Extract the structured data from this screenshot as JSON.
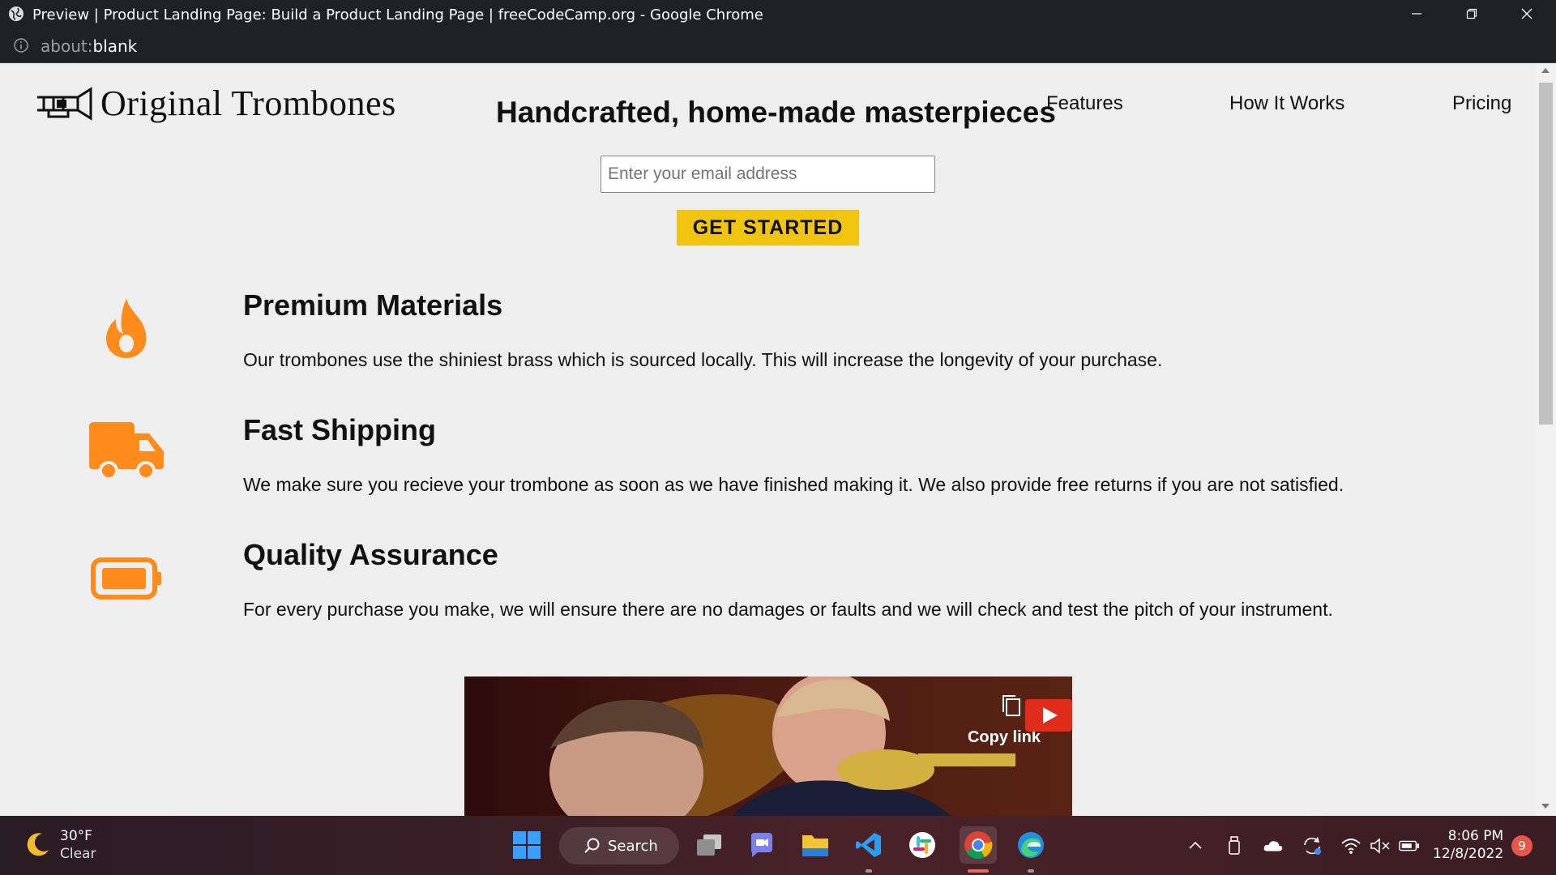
{
  "window": {
    "title": "Preview | Product Landing Page: Build a Product Landing Page | freeCodeCamp.org - Google Chrome"
  },
  "address_bar": {
    "url_prefix": "about:",
    "url_main": "blank"
  },
  "page": {
    "brand": "Original Trombones",
    "nav": [
      {
        "label": "Features"
      },
      {
        "label": "How It Works"
      },
      {
        "label": "Pricing"
      }
    ],
    "hero_title": "Handcrafted, home-made masterpieces",
    "email_placeholder": "Enter your email address",
    "cta_label": "GET STARTED",
    "features": [
      {
        "icon": "flame-icon",
        "title": "Premium Materials",
        "description": "Our trombones use the shiniest brass which is sourced locally. This will increase the longevity of your purchase."
      },
      {
        "icon": "truck-icon",
        "title": "Fast Shipping",
        "description": "We make sure you recieve your trombone as soon as we have finished making it. We also provide free returns if you are not satisfied."
      },
      {
        "icon": "battery-icon",
        "title": "Quality Assurance",
        "description": "For every purchase you make, we will ensure there are no damages or faults and we will check and test the pitch of your instrument."
      }
    ],
    "video": {
      "copy_link": "Copy link"
    },
    "accent_color": "#f1c40f",
    "icon_color": "#ff8c1a"
  },
  "taskbar": {
    "weather_temp": "30°F",
    "weather_condition": "Clear",
    "search_label": "Search",
    "time": "8:06 PM",
    "date": "12/8/2022",
    "notification_count": "9"
  }
}
